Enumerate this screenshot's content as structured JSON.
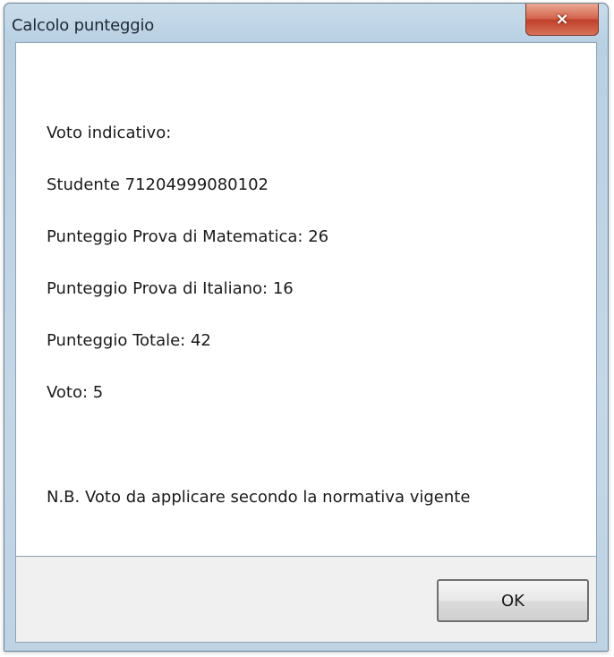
{
  "window": {
    "title": "Calcolo punteggio",
    "close_glyph": "×"
  },
  "content": {
    "lines": [
      "Voto indicativo:",
      "Studente 71204999080102",
      "Punteggio Prova di Matematica: 26",
      "Punteggio Prova di Italiano: 16",
      "Punteggio Totale: 42",
      "Voto: 5"
    ],
    "note": "N.B. Voto da applicare secondo la normativa vigente"
  },
  "buttons": {
    "ok_label": "OK"
  },
  "icons": {
    "close": "close-icon"
  },
  "colors": {
    "close_button": "#c8442c",
    "frame": "#c4d7e7",
    "footer": "#f0f0f0"
  }
}
